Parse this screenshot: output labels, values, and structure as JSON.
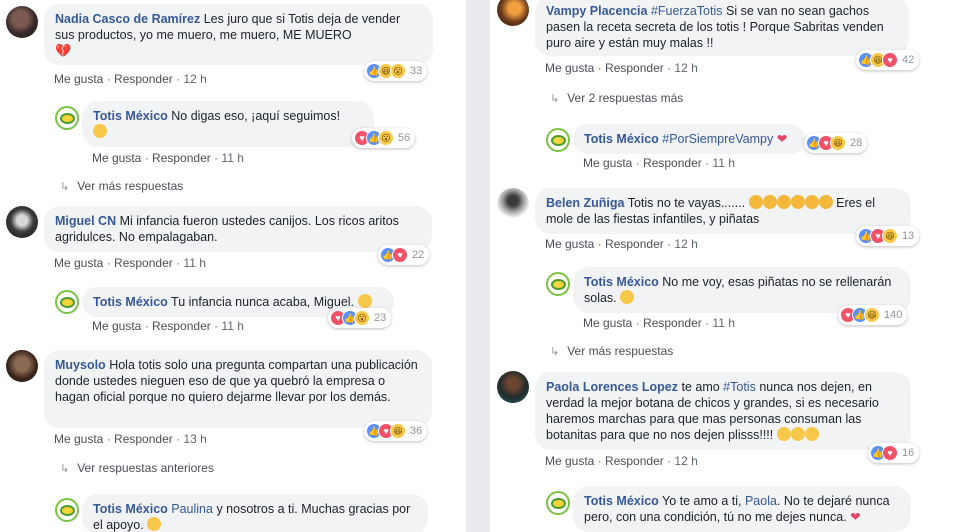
{
  "actions": {
    "like": "Me gusta",
    "reply": "Responder"
  },
  "left": {
    "c1": {
      "author": "Nadia Casco de Ramírez",
      "text": "Les juro que si Totis deja de vender sus productos, yo me muero, me muero, ME MUERO",
      "emoji": "💔",
      "time": "12 h",
      "count": "33"
    },
    "r1": {
      "author": "Totis México",
      "text": "No digas eso, ¡aquí seguimos!",
      "time": "11 h",
      "count": "56"
    },
    "more1": "Ver más respuestas",
    "c2": {
      "author": "Miguel CN",
      "text": "Mi infancia fueron ustedes canijos. Los ricos aritos agridulces. No empalagaban.",
      "time": "11 h",
      "count": "22"
    },
    "r2": {
      "author": "Totis México",
      "text": "Tu infancia nunca acaba, Miguel.",
      "time": "11 h",
      "count": "23"
    },
    "c3": {
      "author": "Muysolo",
      "text": "Hola totis solo una pregunta compartan una publicación donde ustedes nieguen eso de que ya quebró la empresa o hagan oficial porque no quiero dejarme llevar por los demás.",
      "time": "13 h",
      "count": "36"
    },
    "more3": "Ver respuestas anteriores",
    "r3": {
      "author": "Totis México",
      "mention": "Paulina",
      "text": "y nosotros a ti. Muchas gracias por el apoyo."
    }
  },
  "right": {
    "c1": {
      "author": "Vampy Placencia",
      "hashtag": "#FuerzaTotis",
      "text": "Si se van no sean gachos pasen la receta secreta de los totis ! Porque Sabritas venden puro aire y están muy malas !!",
      "time": "12 h",
      "count": "42"
    },
    "more1": "Ver 2 respuestas más",
    "r1": {
      "author": "Totis México",
      "hashtag": "#PorSiempreVampy",
      "emoji": "❤",
      "time": "11 h",
      "count": "28"
    },
    "c2": {
      "author": "Belen Zuñiga",
      "text_before": "Totis no te vayas.......",
      "text_after": "Eres el mole de las fiestas infantiles, y piñatas",
      "time": "12 h",
      "count": "13"
    },
    "r2": {
      "author": "Totis México",
      "text": "No me voy, esas piñatas no se rellenarán solas.",
      "time": "11 h",
      "count": "140"
    },
    "more2": "Ver más respuestas",
    "c3": {
      "author": "Paola Lorences Lopez",
      "text_before": "te amo",
      "hashtag": "#Totis",
      "text_after": "nunca nos dejen, en verdad la mejor botana de chicos y grandes, si es necesario haremos marchas para que mas personas consuman las botanitas para que no nos dejen plisss!!!!",
      "time": "12 h",
      "count": "16"
    },
    "r3": {
      "author": "Totis México",
      "text_before": "Yo te amo a ti,",
      "mention": "Paola",
      "text_after": ". No te dejaré nunca pero, con una condición, tú no me dejes nunca.",
      "emoji": "❤"
    }
  }
}
